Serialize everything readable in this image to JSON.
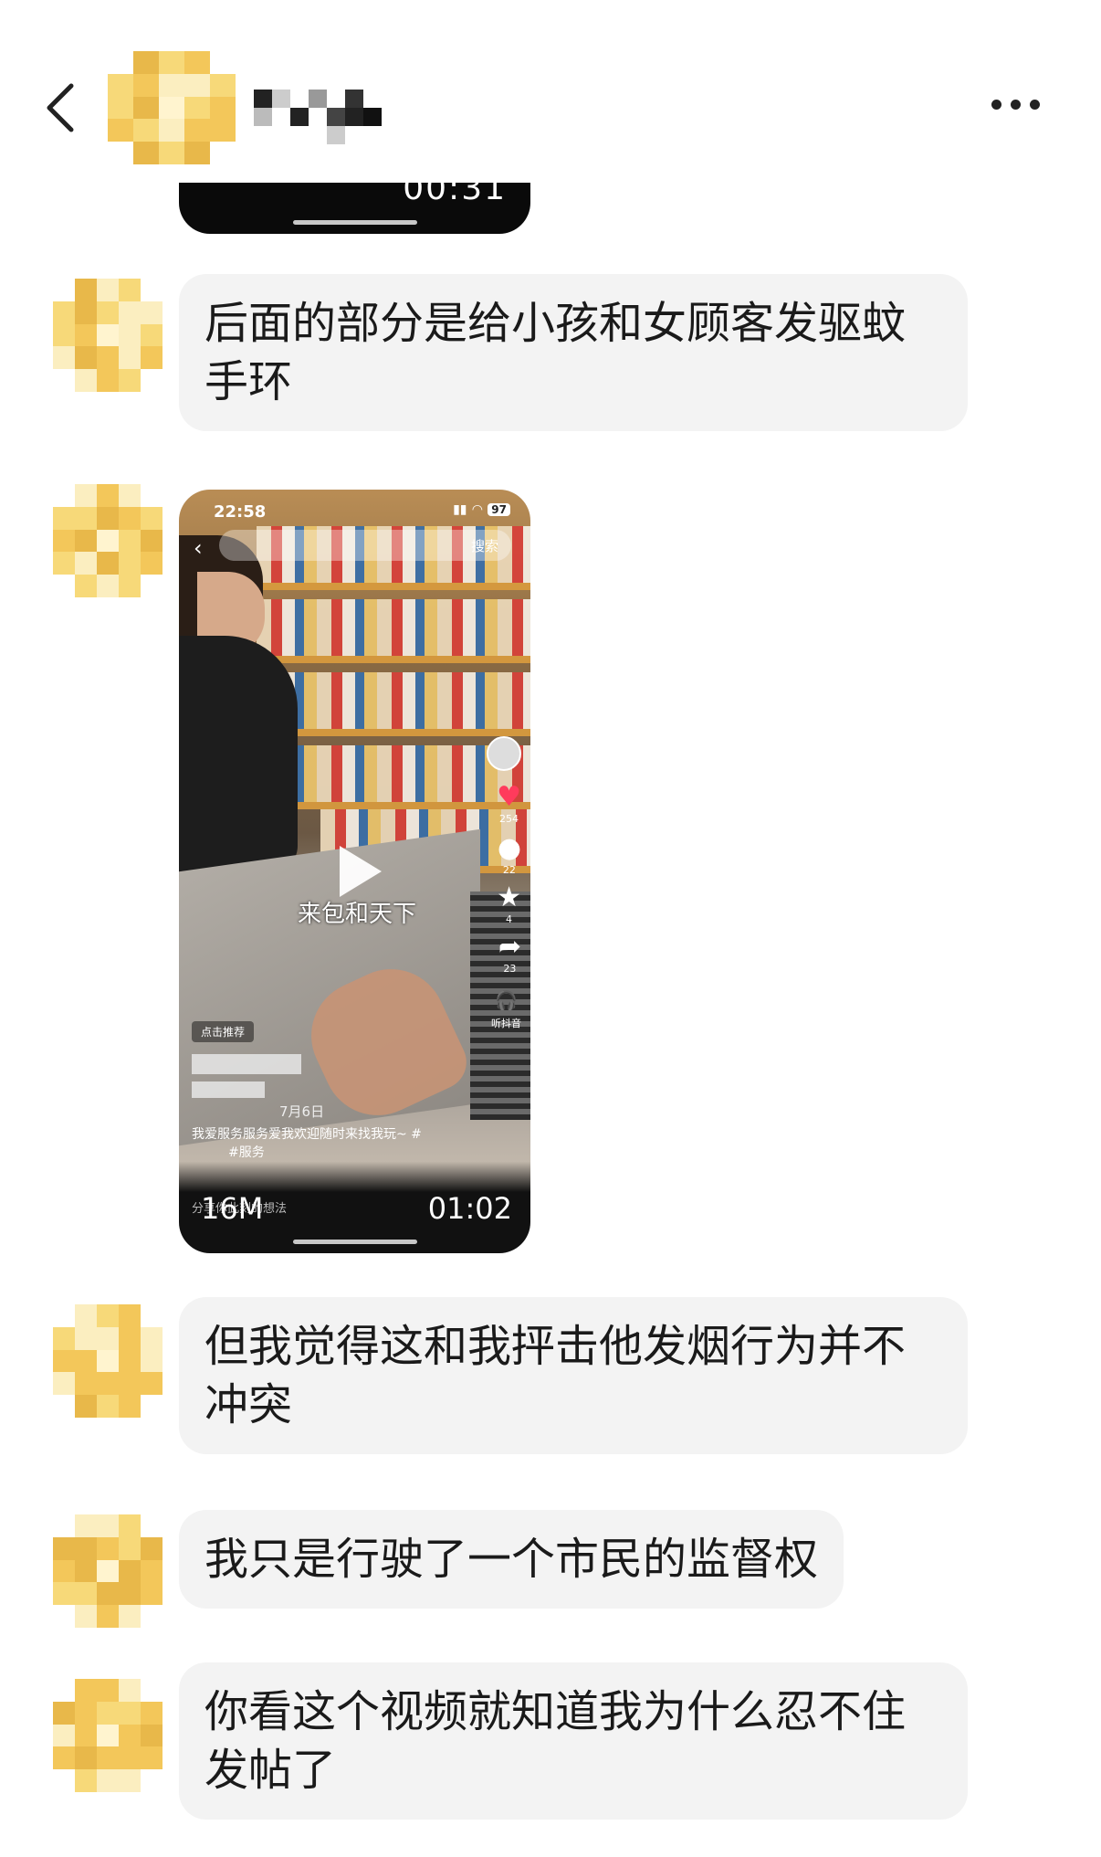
{
  "header": {
    "back_icon": "chevron-left-icon",
    "more_icon": "more-dots-icon"
  },
  "messages": [
    {
      "text": "后面的部分是给小孩和女顾客发驱蚊手环"
    },
    {
      "text": "但我觉得这和我抨击他发烟行为并不冲突"
    },
    {
      "text": "我只是行驶了一个市民的监督权"
    },
    {
      "text": "你看这个视频就知道我为什么忍不住发帖了"
    }
  ],
  "video_top": {
    "ghost_duration": "00:31"
  },
  "video": {
    "status_time": "22:58",
    "battery": "97",
    "search_label": "搜索",
    "caption": "来包和天下",
    "likes": "254",
    "comments": "22",
    "favorites": "4",
    "shares": "23",
    "listen_label": "听抖音",
    "recommend_label": "点击推荐",
    "date": "7月6日",
    "desc_line1": "我爱服务服务爱我欢迎随时来找我玩~ #",
    "desc_line2": "#服务",
    "footer_hint": "分享你此刻的想法",
    "file_size": "16M",
    "duration": "01:02"
  },
  "colors": {
    "bubble_bg": "#f3f3f3",
    "like": "#ff3b5c",
    "avatar_palette": [
      "#f7d979",
      "#f3c75a",
      "#fbeec0",
      "#e8b84a",
      "#fff4cf",
      "#dcdcdc"
    ]
  }
}
